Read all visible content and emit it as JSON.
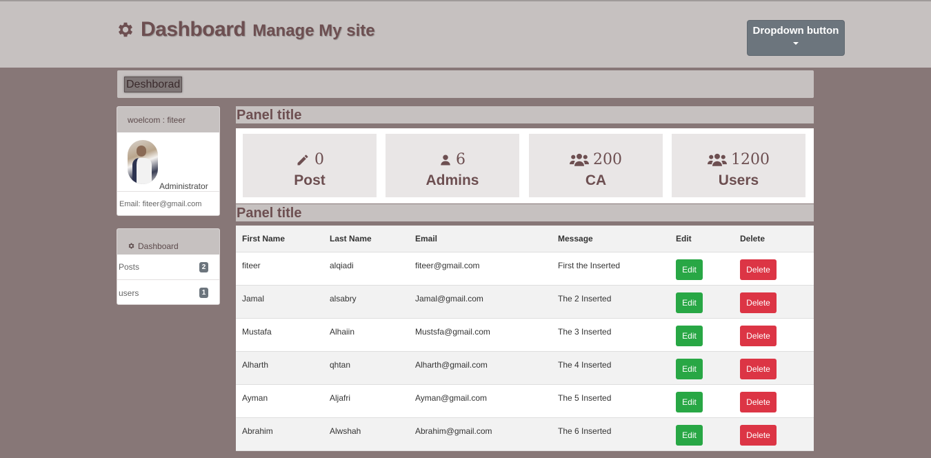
{
  "header": {
    "title": "Dashboard",
    "subtitle": "Manage My site",
    "dropdown_label": "Dropdown button"
  },
  "breadcrumb": {
    "item": "Deshborad"
  },
  "user_card": {
    "welcome": "woelcom : fiteer",
    "role": "Administrator",
    "email": "Email: fiteer@gmail.com"
  },
  "nav": {
    "header": "Dashboard",
    "items": [
      {
        "label": "Posts",
        "count": "2"
      },
      {
        "label": "users",
        "count": "1"
      }
    ]
  },
  "panels": {
    "stats_title": "Panel title",
    "table_title": "Panel title"
  },
  "stats": [
    {
      "icon": "pencil-icon",
      "value": "0",
      "label": "Post"
    },
    {
      "icon": "user-icon",
      "value": "6",
      "label": "Admins"
    },
    {
      "icon": "users-icon",
      "value": "200",
      "label": "CA"
    },
    {
      "icon": "users-icon",
      "value": "1200",
      "label": "Users"
    }
  ],
  "table": {
    "headers": [
      "First Name",
      "Last Name",
      "Email",
      "Message",
      "Edit",
      "Delete"
    ],
    "edit_label": "Edit",
    "delete_label": "Delete",
    "rows": [
      {
        "first": "fiteer",
        "last": "alqiadi",
        "email": "fiteer@gmail.com",
        "message": "First the Inserted"
      },
      {
        "first": "Jamal",
        "last": "alsabry",
        "email": "Jamal@gmail.com",
        "message": "The 2 Inserted"
      },
      {
        "first": "Mustafa",
        "last": "Alhaiin",
        "email": "Mustsfa@gmail.com",
        "message": "The 3 Inserted"
      },
      {
        "first": "Alharth",
        "last": "qhtan",
        "email": "Alharth@gmail.com",
        "message": "The 4 Inserted"
      },
      {
        "first": "Ayman",
        "last": "Aljafri",
        "email": "Ayman@gmail.com",
        "message": "The 5 Inserted"
      },
      {
        "first": "Abrahim",
        "last": "Alwshah",
        "email": "Abrahim@gmail.com",
        "message": "The 6 Inserted"
      }
    ]
  },
  "colors": {
    "page_bg": "#877777",
    "bar_bg": "#c6c1c0",
    "brand_text": "#6d4f51",
    "edit_button": "#28a745",
    "delete_button": "#dc3545",
    "dropdown_button": "#6c757d"
  }
}
